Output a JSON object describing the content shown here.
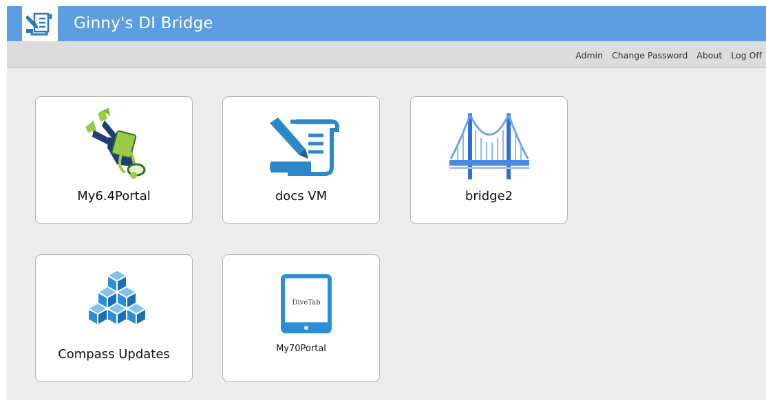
{
  "header": {
    "title": "Ginny's DI Bridge",
    "logo_icon": "scroll-pen-icon",
    "background_color": "#5d9ee3"
  },
  "nav": {
    "links": [
      "Admin",
      "Change Password",
      "About",
      "Log Off"
    ]
  },
  "tiles": [
    {
      "label": "My6.4Portal",
      "icon": "diver-icon"
    },
    {
      "label": "docs VM",
      "icon": "scroll-pen-icon"
    },
    {
      "label": "bridge2",
      "icon": "bridge-icon"
    },
    {
      "label": "Compass Updates",
      "icon": "cubes-icon"
    },
    {
      "label": "My70Portal",
      "icon": "tablet-icon",
      "icon_text": "DiveTab"
    }
  ]
}
